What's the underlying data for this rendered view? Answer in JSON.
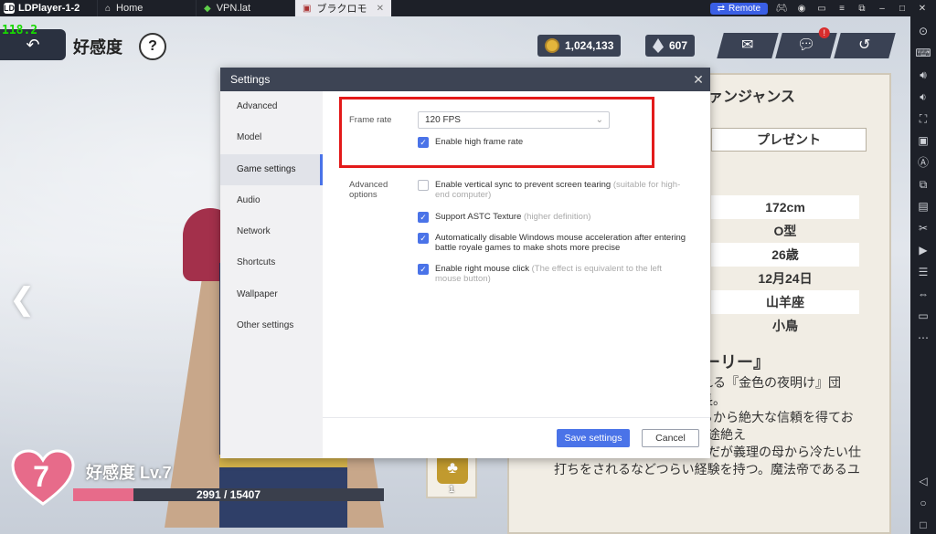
{
  "app": {
    "title": "LDPlayer-1-2",
    "tabs": [
      {
        "label": "Home"
      },
      {
        "label": "VPN.lat"
      },
      {
        "label": "ブラクロモ"
      }
    ],
    "remote_label": "Remote"
  },
  "game": {
    "fps": "118.2",
    "title": "好感度",
    "help": "?",
    "coins": "1,024,133",
    "gems": "607",
    "notice_badge": "!",
    "character_name": "ァンジャンス",
    "present_tab": "プレゼント",
    "profile": [
      "172cm",
      "O型",
      "26歳",
      "12月24日",
      "山羊座",
      "小鳥"
    ],
    "story_title": "ーリー』",
    "story_lines": [
      "れる『金色の夜明け』団長。",
      "ちから絶大な信頼を得てお",
      "ト家に引き取られ跡取りの途絶え",
      "たその家に引き取られた。だが義理の母から冷たい仕",
      "打ちをされるなどつらい経験を持つ。魔法帝であるユ"
    ],
    "affinity_level": "7",
    "affinity_label": "好感度 Lv.7",
    "affinity_progress": "2991 / 15407",
    "affinity_ratio": 0.194,
    "item_qty": "1",
    "item_badge": "!"
  },
  "settings": {
    "title": "Settings",
    "nav": [
      "Advanced",
      "Model",
      "Game settings",
      "Audio",
      "Network",
      "Shortcuts",
      "Wallpaper",
      "Other settings"
    ],
    "active_nav": "Game settings",
    "frame_rate_label": "Frame rate",
    "frame_rate_value": "120 FPS",
    "high_frame_rate": {
      "label": "Enable high frame rate",
      "checked": true
    },
    "advanced_label_1": "Advanced",
    "advanced_label_2": "options",
    "options": [
      {
        "line1": "Enable vertical sync to prevent screen tearing",
        "hint1": "(suitable for high-",
        "line2": "end computer)",
        "checked": false
      },
      {
        "line1": "Support ASTC Texture",
        "hint1": "(higher definition)",
        "line2": "",
        "checked": true
      },
      {
        "line1": "Automatically disable Windows mouse acceleration after entering",
        "hint1": "",
        "line2": "battle royale games to make shots more precise",
        "checked": true
      },
      {
        "line1": "Enable right mouse click",
        "hint1": "(The effect is equivalent to the left",
        "line2": "mouse button)",
        "checked": true
      }
    ],
    "save_label": "Save settings",
    "cancel_label": "Cancel"
  },
  "colors": {
    "accent": "#4a73e8",
    "highlight_box": "#e31a1a",
    "fps_text": "#18d800"
  }
}
